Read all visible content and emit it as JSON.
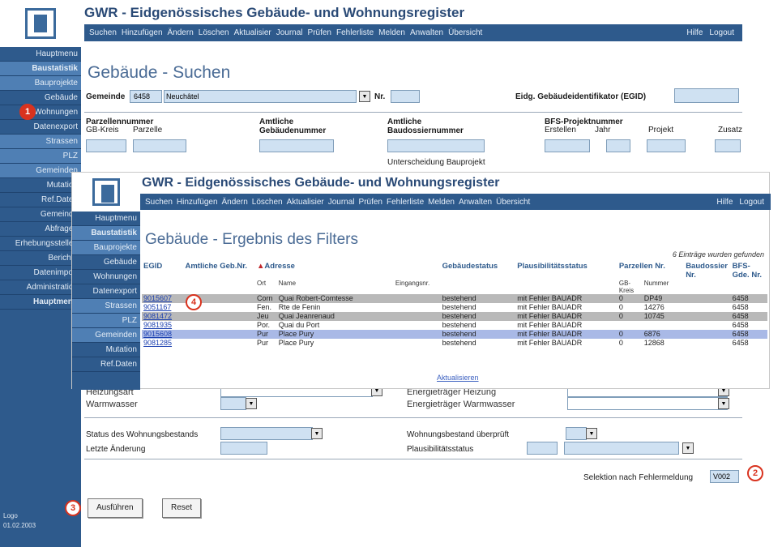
{
  "app": {
    "title": "GWR - Eidgenössisches Gebäude- und Wohnungsregister"
  },
  "nav": {
    "items": [
      "Suchen",
      "Hinzufügen",
      "Ändern",
      "Löschen",
      "Aktualisier",
      "Journal",
      "Prüfen",
      "Fehlerliste",
      "Melden",
      "Anwalten",
      "Übersicht"
    ],
    "help": "Hilfe",
    "logout": "Logout"
  },
  "sidebar": {
    "items": [
      "Hauptmenu",
      "Baustatistik",
      "Bauprojekte",
      "Gebäude",
      "Wohnungen",
      "Datenexport",
      "Strassen",
      "PLZ",
      "Gemeinden",
      "Mutation",
      "Ref.Daten",
      "Gemeinde",
      "Abfragen",
      "Erhebungsstellen",
      "Berichte",
      "Datenimport",
      "Administration",
      "Hauptmenu"
    ],
    "footer_1": "Logo",
    "footer_2": "01.02.2003"
  },
  "search": {
    "heading": "Gebäude - Suchen",
    "gemeinde_label": "Gemeinde",
    "gemeinde_nr": "6458",
    "gemeinde_value": "Neuchâtel",
    "nr_label": "Nr.",
    "egid_label": "Eidg. Gebäudeidentifikator (EGID)",
    "parcel_label": "Parzellennummer",
    "gb_kreis": "GB-Kreis",
    "parzelle": "Parzelle",
    "amtliche_geb_label": "Amtliche Gebäudenummer",
    "amtliche_bau_label": "Amtliche Baudossiernummer",
    "bfs_label": "BFS-Projektnummer",
    "erstellen": "Erstellen",
    "jahr": "Jahr",
    "projekt": "Projekt",
    "zusatz": "Zusatz",
    "unterscheidung": "Unterscheidung Bauprojekt",
    "heizungsart": "Heizungsart",
    "warmwasser": "Warmwasser",
    "energie_heizung": "Energieträger Heizung",
    "energie_warmwasser": "Energieträger Warmwasser",
    "status_wohnung": "Status des Wohnungsbestands",
    "wohnung_ueberprueft": "Wohnungsbestand überprüft",
    "letzte_aenderung": "Letzte Änderung",
    "plausibilitaet": "Plausibilitätsstatus",
    "selektion_label": "Selektion nach Fehlermeldung",
    "selektion_value": "V002",
    "run_button": "Ausführen",
    "reset_button": "Reset"
  },
  "results": {
    "heading": "Gebäude - Ergebnis des Filters",
    "count": "6 Einträge wurden gefunden",
    "headers": {
      "egid": "EGID",
      "amtliche": "Amtliche Geb.Nr.",
      "adresse": "Adresse",
      "adresse_sub_ort": "Ort",
      "adresse_sub_name": "Name",
      "adresse_sub_eingang": "Eingangsnr.",
      "status": "Gebäudestatus",
      "plaus": "Plausibilitätsstatus",
      "parzellen": "Parzellen Nr.",
      "parzellen_sub_kreis": "GB-Kreis",
      "parzellen_sub_nr": "Nummer",
      "baudossier": "Baudossier Nr.",
      "bfs": "BFS-Gde. Nr."
    },
    "rows": [
      {
        "egid": "9015607",
        "ort": "Corn",
        "name": "Quai Robert-Comtesse",
        "status": "bestehend",
        "plaus": "mit Fehler BAUADR",
        "kreis": "0",
        "nr": "DP49",
        "bfs": "6458"
      },
      {
        "egid": "9051167",
        "ort": "Fen.",
        "name": "Rte de Fenin",
        "status": "bestehend",
        "plaus": "mit Fehler BAUADR",
        "kreis": "0",
        "nr": "14276",
        "bfs": "6458"
      },
      {
        "egid": "9081472",
        "ort": "Jeu",
        "name": "Quai Jeanrenaud",
        "status": "bestehend",
        "plaus": "mit Fehler BAUADR",
        "kreis": "0",
        "nr": "10745",
        "bfs": "6458"
      },
      {
        "egid": "9081935",
        "ort": "Por.",
        "name": "Quai du Port",
        "status": "bestehend",
        "plaus": "mit Fehler BAUADR",
        "kreis": "",
        "nr": "",
        "bfs": "6458"
      },
      {
        "egid": "9015608",
        "ort": "Pur",
        "name": "Place Pury",
        "status": "bestehend",
        "plaus": "mit Fehler BAUADR",
        "kreis": "0",
        "nr": "6876",
        "bfs": "6458"
      },
      {
        "egid": "9081285",
        "ort": "Pur",
        "name": "Place Pury",
        "status": "bestehend",
        "plaus": "mit Fehler BAUADR",
        "kreis": "0",
        "nr": "12868",
        "bfs": "6458"
      }
    ],
    "update_link": "Aktualisieren"
  },
  "badges": [
    "1",
    "2",
    "3",
    "4"
  ],
  "colors": {
    "brand": "#2e5a8c",
    "badge": "#d9331f",
    "input": "#cfe1f2"
  }
}
